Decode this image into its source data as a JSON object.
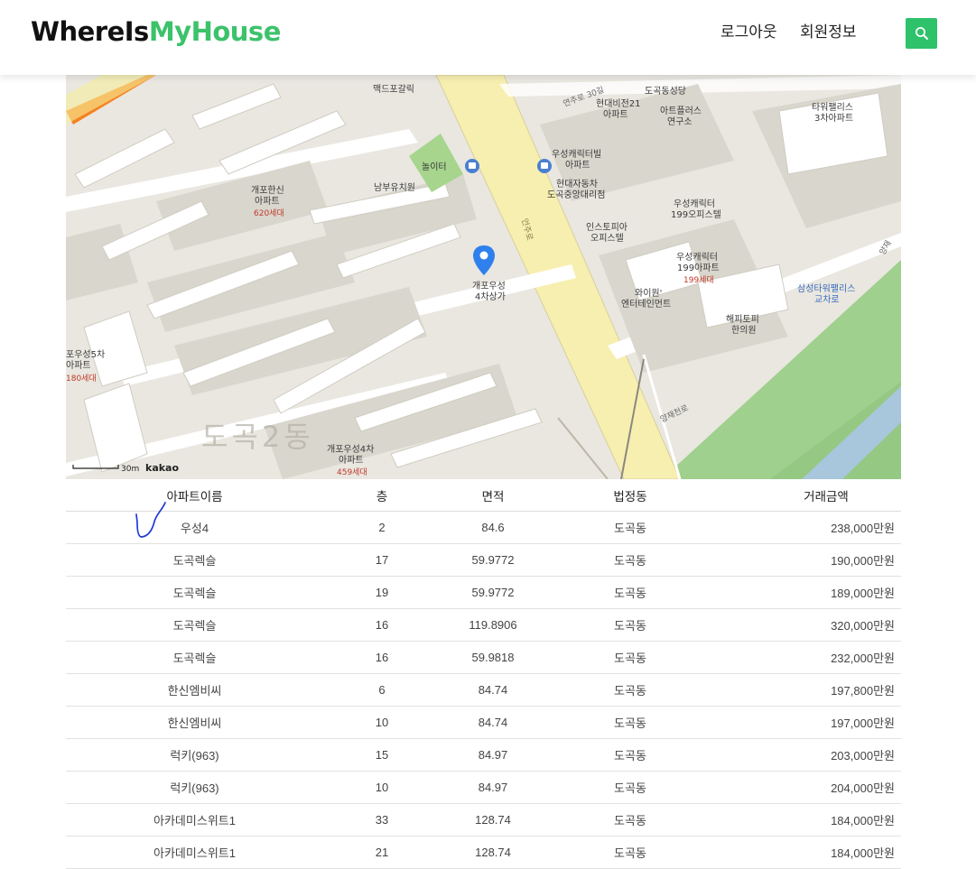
{
  "header": {
    "logo_part1": "WhereIs",
    "logo_part2": "MyHouse",
    "nav": {
      "logout": "로그아웃",
      "profile": "회원정보"
    },
    "search_icon": "search-icon",
    "accent": "#2ec26a"
  },
  "map": {
    "labels": {
      "mcd": "맥드포갈릭",
      "church": "도곡동성당",
      "hyundai21": "현대비전21",
      "apt": "아파트",
      "artplus": "아트플러스",
      "research": "연구소",
      "tower": "타워팰리스",
      "tower3": "3차아파트",
      "playground": "놀이터",
      "kinder": "남부유치원",
      "hanshin": "개포한신",
      "hanshin_units": "620세대",
      "woosung_cv": "우성캐릭터빌",
      "hyundai_cars": "현대자동차",
      "dealer": "도곡중앙대리점",
      "woosung199": "우성캐릭터",
      "office199": "199오피스텔",
      "instopia": "인스토피아",
      "officetel": "오피스텔",
      "woosung199b": "199아파트",
      "units199": "199세대",
      "marker1": "개포우성",
      "marker2": "4차상가",
      "wine": "와이원'",
      "wine2": "엔터테인먼트",
      "happy": "해피토피",
      "happy2": "한의원",
      "samsung": "삼성타워팰리스",
      "samsung2": "교차로",
      "w5": "포우성5차",
      "w5units": "180세대",
      "dong": "도곡2동",
      "w4": "개포우성4차",
      "w4units": "459세대",
      "yeonju": "연주로 30길",
      "yangjae": "양재천로",
      "yangjae2": "양재",
      "scale": "30m",
      "kakao": "kakao",
      "road_label": "언주로"
    },
    "marker_icon": "map-pin-icon"
  },
  "table": {
    "headers": [
      "아파트이름",
      "층",
      "면적",
      "법정동",
      "거래금액"
    ],
    "rows": [
      [
        "우성4",
        "2",
        "84.6",
        "도곡동",
        "238,000만원"
      ],
      [
        "도곡렉슬",
        "17",
        "59.9772",
        "도곡동",
        "190,000만원"
      ],
      [
        "도곡렉슬",
        "19",
        "59.9772",
        "도곡동",
        "189,000만원"
      ],
      [
        "도곡렉슬",
        "16",
        "119.8906",
        "도곡동",
        "320,000만원"
      ],
      [
        "도곡렉슬",
        "16",
        "59.9818",
        "도곡동",
        "232,000만원"
      ],
      [
        "한신엠비씨",
        "6",
        "84.74",
        "도곡동",
        "197,800만원"
      ],
      [
        "한신엠비씨",
        "10",
        "84.74",
        "도곡동",
        "197,000만원"
      ],
      [
        "럭키(963)",
        "15",
        "84.97",
        "도곡동",
        "203,000만원"
      ],
      [
        "럭키(963)",
        "10",
        "84.97",
        "도곡동",
        "204,000만원"
      ],
      [
        "아카데미스위트1",
        "33",
        "128.74",
        "도곡동",
        "184,000만원"
      ],
      [
        "아카데미스위트1",
        "21",
        "128.74",
        "도곡동",
        "184,000만원"
      ]
    ]
  }
}
